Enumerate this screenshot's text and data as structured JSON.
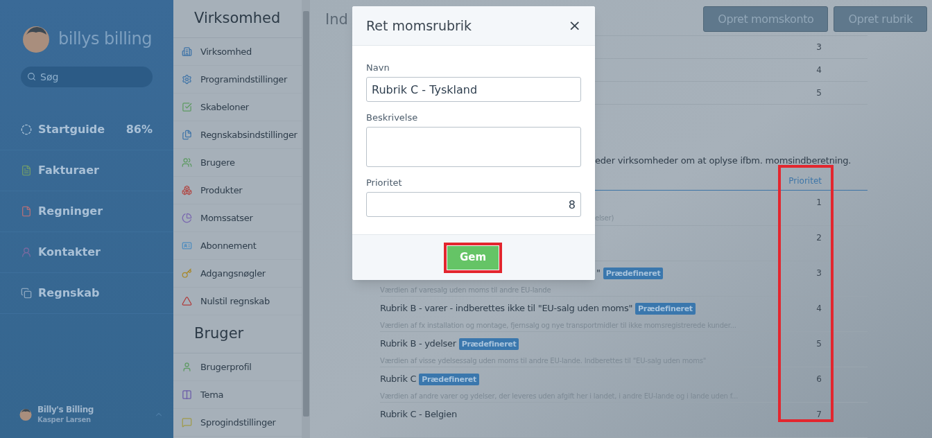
{
  "sidebar": {
    "logo": "billys billing",
    "search": {
      "placeholder": "Søg"
    },
    "nav": [
      {
        "label": "Startguide",
        "badge": "86%"
      },
      {
        "label": "Fakturaer"
      },
      {
        "label": "Regninger"
      },
      {
        "label": "Kontakter"
      },
      {
        "label": "Regnskab"
      }
    ],
    "user": {
      "company": "Billy's Billing",
      "name": "Kasper Larsen"
    }
  },
  "settings_menu": {
    "sections": [
      {
        "title": "Virksomhed",
        "items": [
          "Virksomhed",
          "Programindstillinger",
          "Skabeloner",
          "Regnskabsindstillinger",
          "Brugere",
          "Produkter",
          "Momssatser",
          "Abonnement",
          "Adgangsnøgler",
          "Nulstil regnskab"
        ]
      },
      {
        "title": "Bruger",
        "items": [
          "Brugerprofil",
          "Tema",
          "Sprogindstillinger"
        ]
      }
    ]
  },
  "page": {
    "title": "Ind",
    "buttons": [
      "Opret momskonto",
      "Opret rubrik"
    ],
    "upper_table": {
      "rows": [
        {
          "priority": "3"
        },
        {
          "priority": "4"
        },
        {
          "priority": "5"
        }
      ]
    },
    "description": "eder virksomheder om at oplyse ifbm. momsindberetning.",
    "table": {
      "columns": [
        "Prioritet"
      ],
      "rows": [
        {
          "description": "elser)",
          "description_clipped": true,
          "priority": "1"
        },
        {
          "priority": "2"
        },
        {
          "title": "\"",
          "title_clipped": true,
          "badge": "Prædefineret",
          "description": "Værdien af varesalg uden moms til andre EU-lande",
          "priority": "3"
        },
        {
          "title": "Rubrik B - varer - indberettes ikke til \"EU-salg uden moms\"",
          "badge": "Prædefineret",
          "description": "Værdien af fx installation og montage, fjernsalg og nye transportmidler til ikke momsregistrerede kunder...",
          "priority": "4"
        },
        {
          "title": "Rubrik B - ydelser",
          "badge": "Prædefineret",
          "description": "Værdien af visse ydelsessalg uden moms til andre EU-lande. Indberettes til \"EU-salg uden moms\"",
          "priority": "5"
        },
        {
          "title": "Rubrik C",
          "badge": "Prædefineret",
          "description": "Værdien af andre varer og ydelser, der leveres uden afgift her i landet, i andre EU-lande og i lande uden f...",
          "priority": "6"
        },
        {
          "title": "Rubrik C - Belgien",
          "priority": "7"
        }
      ]
    }
  },
  "modal": {
    "title": "Ret momsrubrik",
    "close": "×",
    "fields": [
      {
        "label": "Navn",
        "value": "Rubrik C - Tyskland",
        "kind": "text"
      },
      {
        "label": "Beskrivelse",
        "kind": "textarea"
      },
      {
        "label": "Prioritet",
        "value": "8",
        "kind": "number"
      }
    ],
    "save_button": "Gem"
  }
}
